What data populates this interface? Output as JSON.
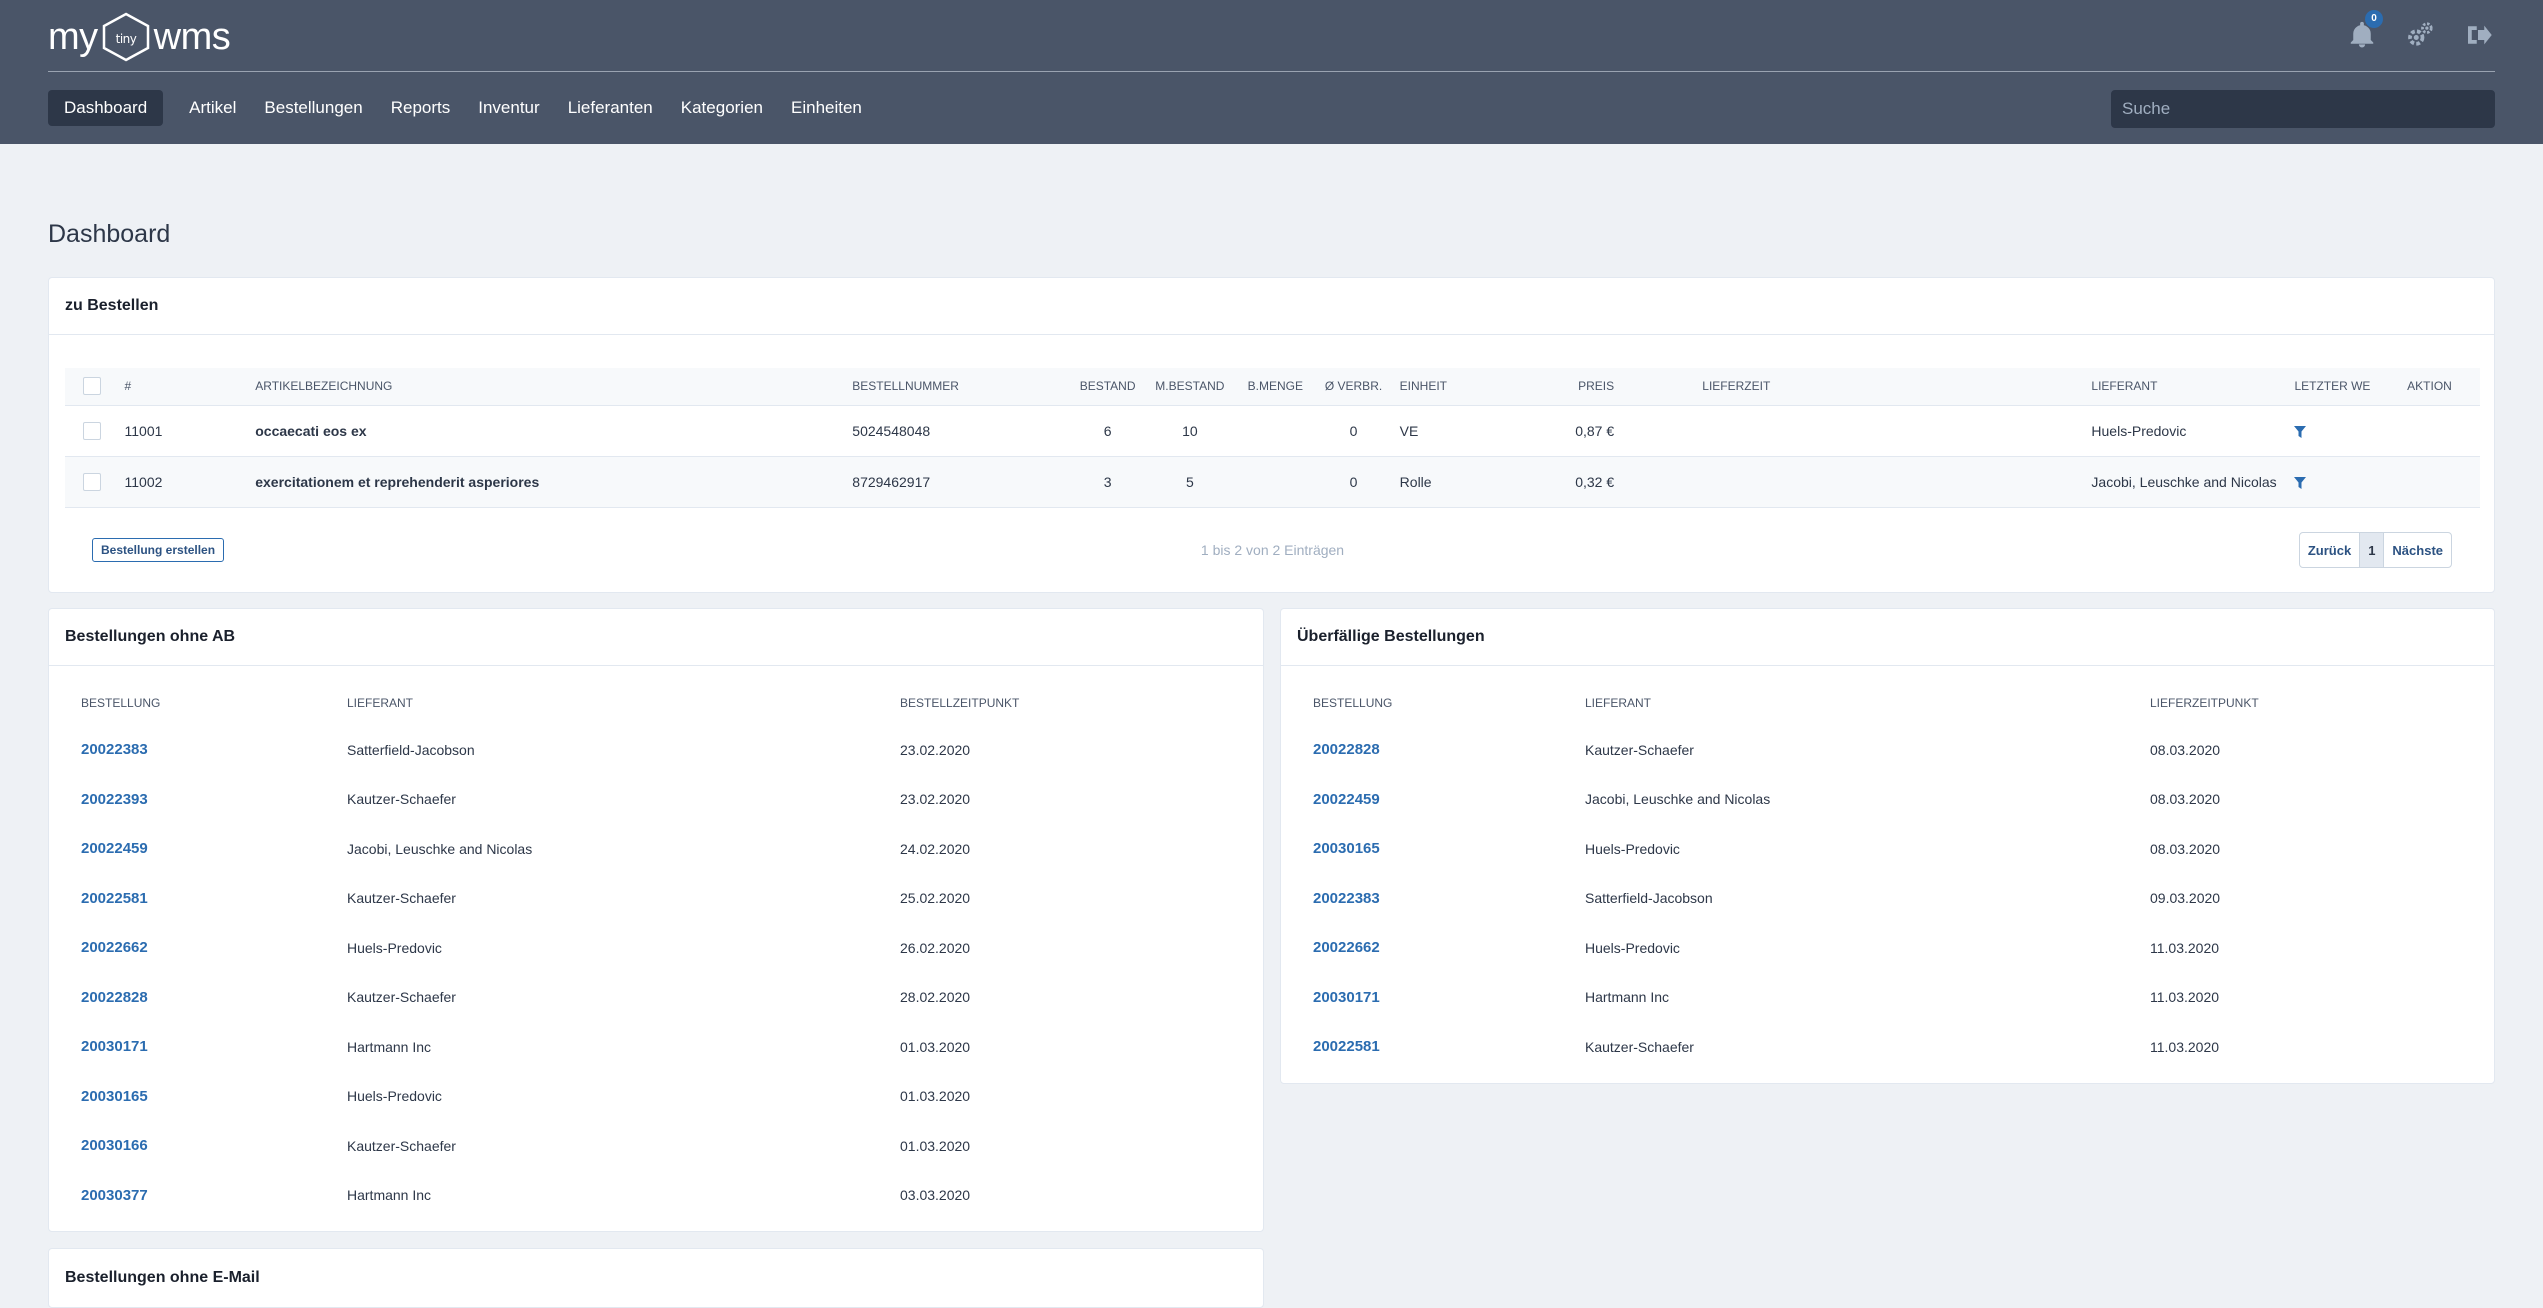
{
  "app": {
    "logo_left": "my",
    "logo_inner": "tiny",
    "logo_right": "wms",
    "notification_count": "0"
  },
  "nav": {
    "items": [
      "Dashboard",
      "Artikel",
      "Bestellungen",
      "Reports",
      "Inventur",
      "Lieferanten",
      "Kategorien",
      "Einheiten"
    ],
    "active": "Dashboard"
  },
  "search": {
    "placeholder": "Suche"
  },
  "page": {
    "title": "Dashboard"
  },
  "zu_bestellen": {
    "title": "zu Bestellen",
    "columns": [
      "#",
      "Artikelbezeichnung",
      "Bestellnummer",
      "Bestand",
      "M.Bestand",
      "B.Menge",
      "Ø Verbr.",
      "Einheit",
      "Preis",
      "Lieferzeit",
      "Lieferant",
      "Letzter WE",
      "Aktion"
    ],
    "rows": [
      {
        "id": "11001",
        "name": "occaecati eos ex",
        "order_no": "5024548048",
        "stock": "6",
        "min_stock": "10",
        "order_qty": "",
        "avg_use": "0",
        "unit": "VE",
        "price": "0,87 €",
        "lead_time": "",
        "supplier": "Huels-Predovic",
        "last_we": ""
      },
      {
        "id": "11002",
        "name": "exercitationem et reprehenderit asperiores",
        "order_no": "8729462917",
        "stock": "3",
        "min_stock": "5",
        "order_qty": "",
        "avg_use": "0",
        "unit": "Rolle",
        "price": "0,32 €",
        "lead_time": "",
        "supplier": "Jacobi, Leuschke and Nicolas",
        "last_we": ""
      }
    ],
    "create_button": "Bestellung erstellen",
    "info": "1 bis 2 von 2 Einträgen",
    "pager": {
      "prev": "Zurück",
      "current": "1",
      "next": "Nächste"
    }
  },
  "ohne_ab": {
    "title": "Bestellungen ohne AB",
    "columns": [
      "Bestellung",
      "Lieferant",
      "Bestellzeitpunkt"
    ],
    "rows": [
      [
        "20022383",
        "Satterfield-Jacobson",
        "23.02.2020"
      ],
      [
        "20022393",
        "Kautzer-Schaefer",
        "23.02.2020"
      ],
      [
        "20022459",
        "Jacobi, Leuschke and Nicolas",
        "24.02.2020"
      ],
      [
        "20022581",
        "Kautzer-Schaefer",
        "25.02.2020"
      ],
      [
        "20022662",
        "Huels-Predovic",
        "26.02.2020"
      ],
      [
        "20022828",
        "Kautzer-Schaefer",
        "28.02.2020"
      ],
      [
        "20030171",
        "Hartmann Inc",
        "01.03.2020"
      ],
      [
        "20030165",
        "Huels-Predovic",
        "01.03.2020"
      ],
      [
        "20030166",
        "Kautzer-Schaefer",
        "01.03.2020"
      ],
      [
        "20030377",
        "Hartmann Inc",
        "03.03.2020"
      ]
    ]
  },
  "ueberfaellig": {
    "title": "Überfällige Bestellungen",
    "columns": [
      "Bestellung",
      "Lieferant",
      "Lieferzeitpunkt"
    ],
    "rows": [
      [
        "20022828",
        "Kautzer-Schaefer",
        "08.03.2020"
      ],
      [
        "20022459",
        "Jacobi, Leuschke and Nicolas",
        "08.03.2020"
      ],
      [
        "20030165",
        "Huels-Predovic",
        "08.03.2020"
      ],
      [
        "20022383",
        "Satterfield-Jacobson",
        "09.03.2020"
      ],
      [
        "20022662",
        "Huels-Predovic",
        "11.03.2020"
      ],
      [
        "20030171",
        "Hartmann Inc",
        "11.03.2020"
      ],
      [
        "20022581",
        "Kautzer-Schaefer",
        "11.03.2020"
      ]
    ]
  },
  "ohne_email": {
    "title": "Bestellungen ohne E-Mail"
  }
}
